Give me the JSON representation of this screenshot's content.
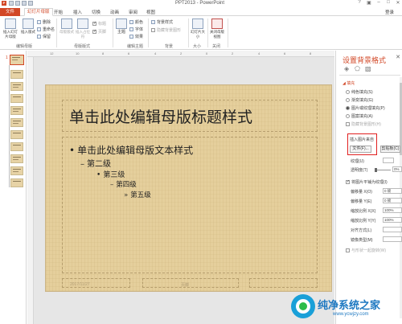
{
  "window": {
    "title": "PPT2013 - PowerPoint",
    "sign_in": "登录"
  },
  "tabs": [
    {
      "label": "文件"
    },
    {
      "label": "幻灯片母版"
    },
    {
      "label": "开始"
    },
    {
      "label": "插入"
    },
    {
      "label": "切换"
    },
    {
      "label": "动画"
    },
    {
      "label": "审阅"
    },
    {
      "label": "视图"
    }
  ],
  "ribbon": {
    "insert_slide_master": "插入幻灯片母版",
    "insert_layout": "插入版式",
    "rename": "重命名",
    "preserve": "保留",
    "delete": "删除",
    "group_edit_master": "编辑母版",
    "master_layout": "母版版式",
    "insert_placeholder": "插入占位符",
    "title_chk": "标题",
    "footer_chk": "页脚",
    "group_master_layout": "母版版式",
    "themes": "主题",
    "colors": "颜色",
    "fonts": "字体",
    "effects": "效果",
    "group_edit_theme": "编辑主题",
    "background_styles": "背景样式",
    "hide_bg_graphics": "隐藏背景图形",
    "group_background": "背景",
    "slide_size": "幻灯片大小",
    "group_size": "大小",
    "close_master_view": "关闭母版视图",
    "group_close": "关闭"
  },
  "thumbnails": {
    "first_number": "1"
  },
  "slide": {
    "title": "单击此处编辑母版标题样式",
    "level1": "单击此处编辑母版文本样式",
    "level2": "第二级",
    "level3": "第三级",
    "level4": "第四级",
    "level5": "第五级",
    "footer_date": "2017/11/27",
    "footer_mid": "页脚"
  },
  "pane": {
    "title": "设置背景格式",
    "fill_header": "◢ 填充",
    "opt_solid": "纯色填充(S)",
    "opt_gradient": "渐变填充(G)",
    "opt_picture": "图片或纹理填充(P)",
    "opt_pattern": "图案填充(A)",
    "opt_hide": "隐藏背景图形(H)",
    "insert_from": "插入图片来自",
    "file_btn": "文件(F)...",
    "clipboard_btn": "剪贴板(C)",
    "texture": "纹理(U)",
    "transparency": "透明度(T)",
    "transparency_value": "0%",
    "tile": "将图片平铺为纹理(I)",
    "offset_x": "偏移量 X(O)",
    "offset_x_value": "0 磅",
    "offset_y": "偏移量 Y(E)",
    "offset_y_value": "0 磅",
    "scale_x": "缩放比例 X(X)",
    "scale_x_value": "100%",
    "scale_y": "缩放比例 Y(Y)",
    "scale_y_value": "100%",
    "alignment": "对齐方式(L)",
    "mirror": "镜像类型(M)",
    "rotate": "与形状一起旋转(W)"
  },
  "watermark": {
    "name": "纯净系统之家",
    "url": "www.ycwjzy.com"
  },
  "colors": {
    "accent": "#d24726",
    "slide_bg": "#e5cf9c"
  }
}
